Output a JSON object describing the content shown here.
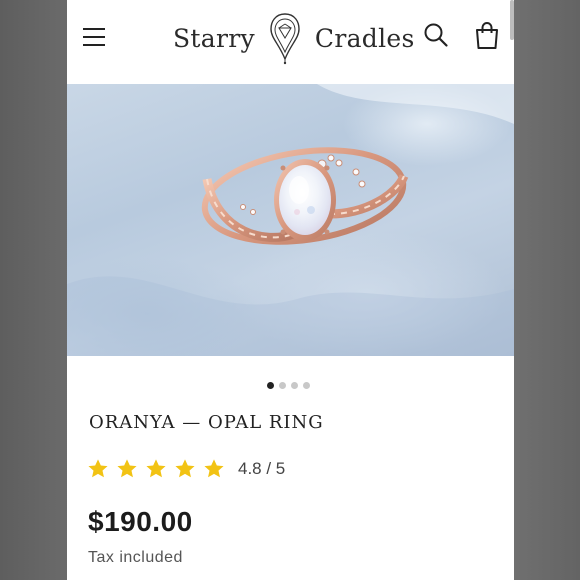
{
  "header": {
    "brand_left": "Starry",
    "brand_right": "Cradles",
    "icons": [
      "hamburger-menu-icon",
      "brand-logo-icon",
      "search-icon",
      "cart-icon"
    ]
  },
  "gallery": {
    "slide_count": 4,
    "active_index": 0
  },
  "product": {
    "title": "ORANYA — OPAL RING",
    "rating": 4.8,
    "rating_max": 5,
    "rating_text": "4.8 / 5",
    "price": "$190.00",
    "tax_note": "Tax included"
  },
  "colors": {
    "star": "#F2C314",
    "text": "#222222",
    "ring_gold": "#D9A08A"
  }
}
